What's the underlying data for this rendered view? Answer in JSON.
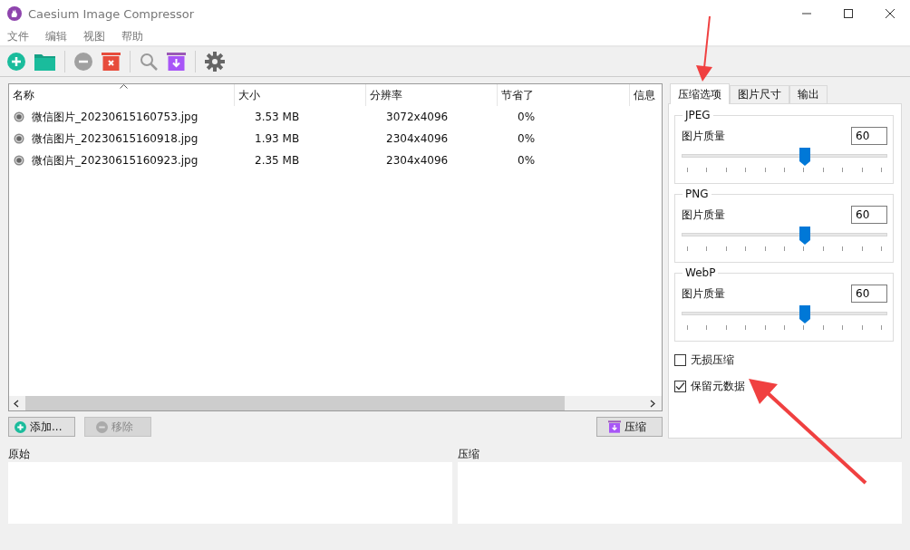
{
  "window": {
    "title": "Caesium Image Compressor"
  },
  "menu": [
    "文件",
    "编辑",
    "视图",
    "帮助"
  ],
  "table": {
    "columns": [
      "名称",
      "大小",
      "分辨率",
      "节省了",
      "信息"
    ],
    "rows": [
      {
        "name": "微信图片_20230615160753.jpg",
        "size": "3.53 MB",
        "resolution": "3072x4096",
        "saved": "0%"
      },
      {
        "name": "微信图片_20230615160918.jpg",
        "size": "1.93 MB",
        "resolution": "2304x4096",
        "saved": "0%"
      },
      {
        "name": "微信图片_20230615160923.jpg",
        "size": "2.35 MB",
        "resolution": "2304x4096",
        "saved": "0%"
      }
    ]
  },
  "buttons": [
    {
      "label": "添加...",
      "kind": "add",
      "disabled": false
    },
    {
      "label": "移除",
      "kind": "remove",
      "disabled": true
    },
    {
      "label": "压缩",
      "kind": "compress",
      "disabled": false
    }
  ],
  "tabs": [
    {
      "label": "压缩选项",
      "selected": true
    },
    {
      "label": "图片尺寸",
      "selected": false
    },
    {
      "label": "输出",
      "selected": false
    }
  ],
  "groups": [
    {
      "title": "JPEG",
      "quality_label": "图片质量",
      "value": "60",
      "level": 0.6
    },
    {
      "title": "PNG",
      "quality_label": "图片质量",
      "value": "60",
      "level": 0.6
    },
    {
      "title": "WebP",
      "quality_label": "图片质量",
      "value": "60",
      "level": 0.6
    }
  ],
  "checkboxes": [
    {
      "label": "无损压缩",
      "checked": false
    },
    {
      "label": "保留元数据",
      "checked": true
    }
  ],
  "previews": [
    "原始",
    "压缩"
  ]
}
